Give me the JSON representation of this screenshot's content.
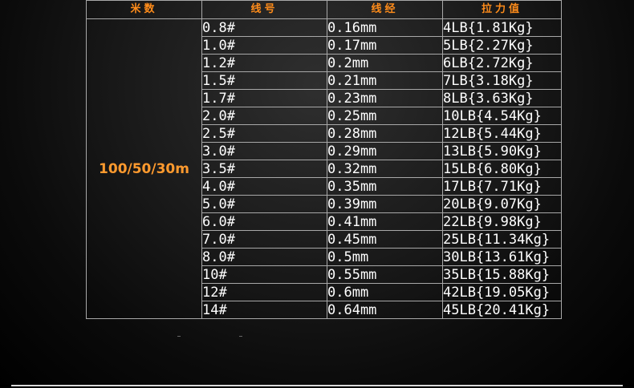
{
  "headers": {
    "length": "米数",
    "line_no": "线号",
    "diameter": "线经",
    "tension": "拉力值"
  },
  "length_value": "100/50/30m",
  "rows": [
    {
      "no": "0.8#",
      "dia": "0.16mm",
      "ten": "4LB{1.81Kg}"
    },
    {
      "no": "1.0#",
      "dia": "0.17mm",
      "ten": "5LB{2.27Kg}"
    },
    {
      "no": "1.2#",
      "dia": "0.2mm",
      "ten": "6LB{2.72Kg}"
    },
    {
      "no": "1.5#",
      "dia": "0.21mm",
      "ten": "7LB{3.18Kg}"
    },
    {
      "no": "1.7#",
      "dia": "0.23mm",
      "ten": "8LB{3.63Kg}"
    },
    {
      "no": "2.0#",
      "dia": "0.25mm",
      "ten": "10LB{4.54Kg}"
    },
    {
      "no": "2.5#",
      "dia": "0.28mm",
      "ten": "12LB{5.44Kg}"
    },
    {
      "no": "3.0#",
      "dia": "0.29mm",
      "ten": "13LB{5.90Kg}"
    },
    {
      "no": "3.5#",
      "dia": "0.32mm",
      "ten": "15LB{6.80Kg}"
    },
    {
      "no": "4.0#",
      "dia": "0.35mm",
      "ten": "17LB{7.71Kg}"
    },
    {
      "no": "5.0#",
      "dia": "0.39mm",
      "ten": "20LB{9.07Kg}"
    },
    {
      "no": "6.0#",
      "dia": "0.41mm",
      "ten": "22LB{9.98Kg}"
    },
    {
      "no": "7.0#",
      "dia": "0.45mm",
      "ten": "25LB{11.34Kg}"
    },
    {
      "no": "8.0#",
      "dia": "0.5mm",
      "ten": "30LB{13.61Kg}"
    },
    {
      "no": "10#",
      "dia": "0.55mm",
      "ten": "35LB{15.88Kg}"
    },
    {
      "no": "12#",
      "dia": "0.6mm",
      "ten": "42LB{19.05Kg}"
    },
    {
      "no": "14#",
      "dia": "0.64mm",
      "ten": "45LB{20.41Kg}"
    }
  ],
  "colors": {
    "header_text": "#ff8c1a",
    "length_text": "#ff9a2e",
    "cell_text": "#ffffff",
    "grid": "#a8a8a8",
    "background": "#000000"
  }
}
